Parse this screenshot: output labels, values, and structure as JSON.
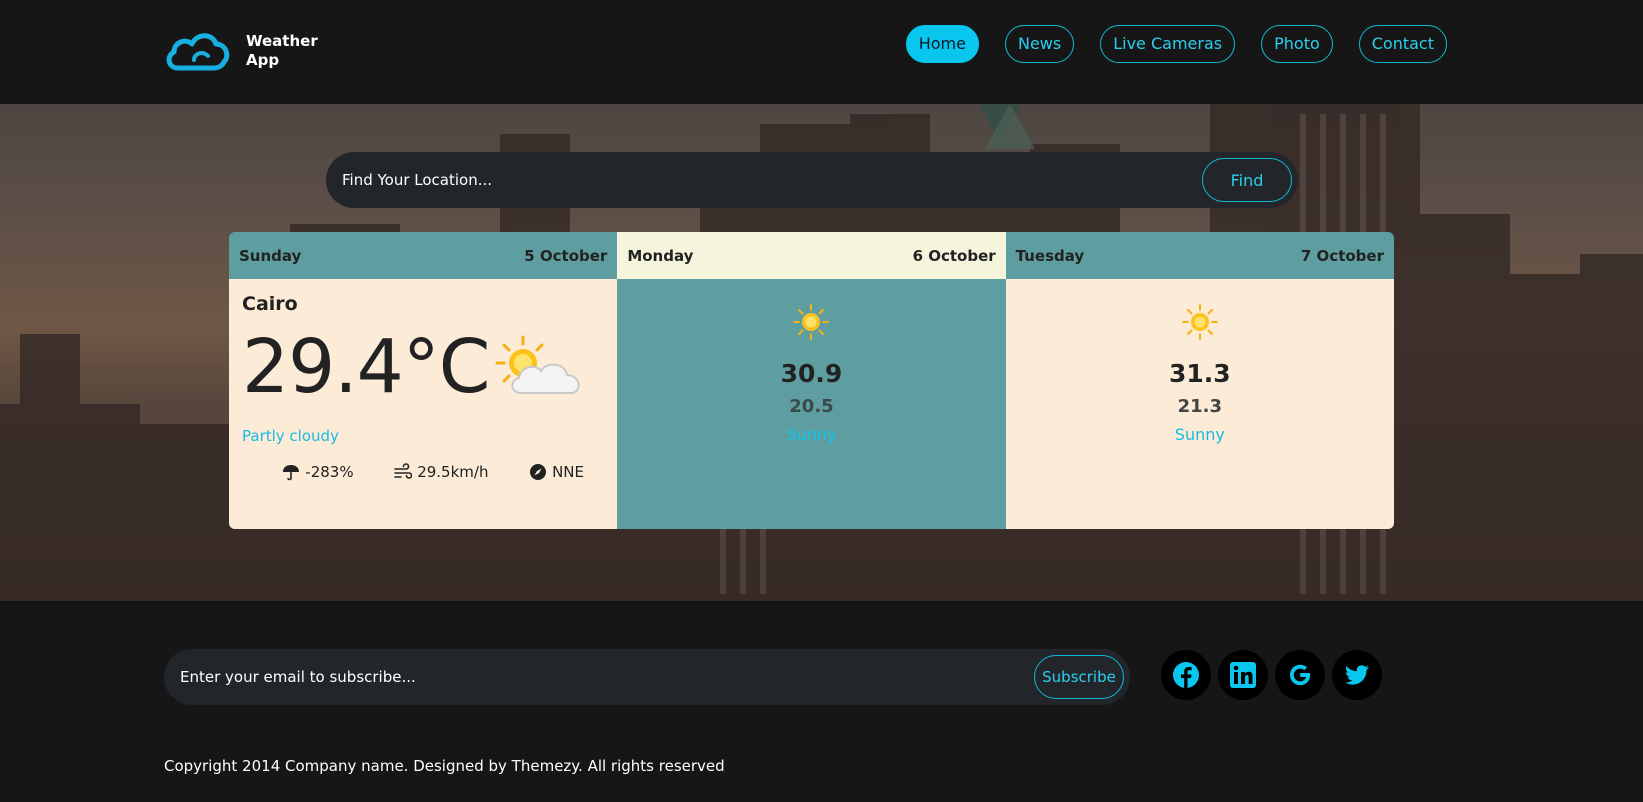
{
  "app": {
    "title_line1": "Weather",
    "title_line2": "App"
  },
  "nav": [
    {
      "label": "Home",
      "active": true
    },
    {
      "label": "News"
    },
    {
      "label": "Live Cameras"
    },
    {
      "label": "Photo"
    },
    {
      "label": "Contact"
    }
  ],
  "search": {
    "placeholder": "Find Your Location...",
    "button": "Find"
  },
  "forecast": {
    "today": {
      "day": "Sunday",
      "date": "5 October",
      "city": "Cairo",
      "temperature": "29.4°C",
      "condition": "Partly cloudy",
      "condition_icon": "partly-cloudy-icon",
      "rain": "-283%",
      "wind": "29.5km/h",
      "direction": "NNE"
    },
    "day2": {
      "day": "Monday",
      "date": "6 October",
      "max": "30.9",
      "min": "20.5",
      "condition": "Sunny",
      "icon": "sun-icon"
    },
    "day3": {
      "day": "Tuesday",
      "date": "7 October",
      "max": "31.3",
      "min": "21.3",
      "condition": "Sunny",
      "icon": "sun-icon"
    }
  },
  "subscribe": {
    "placeholder": "Enter your email to subscribe...",
    "button": "Subscribe"
  },
  "socials": [
    "facebook-icon",
    "linkedin-icon",
    "google-icon",
    "twitter-icon"
  ],
  "copyright": "Copyright 2014 Company name. Designed by Themezy. All rights reserved",
  "colors": {
    "accent": "#09c6ef",
    "teal": "#5e9ea1",
    "cream": "#fbebd7",
    "background": "#161617"
  }
}
